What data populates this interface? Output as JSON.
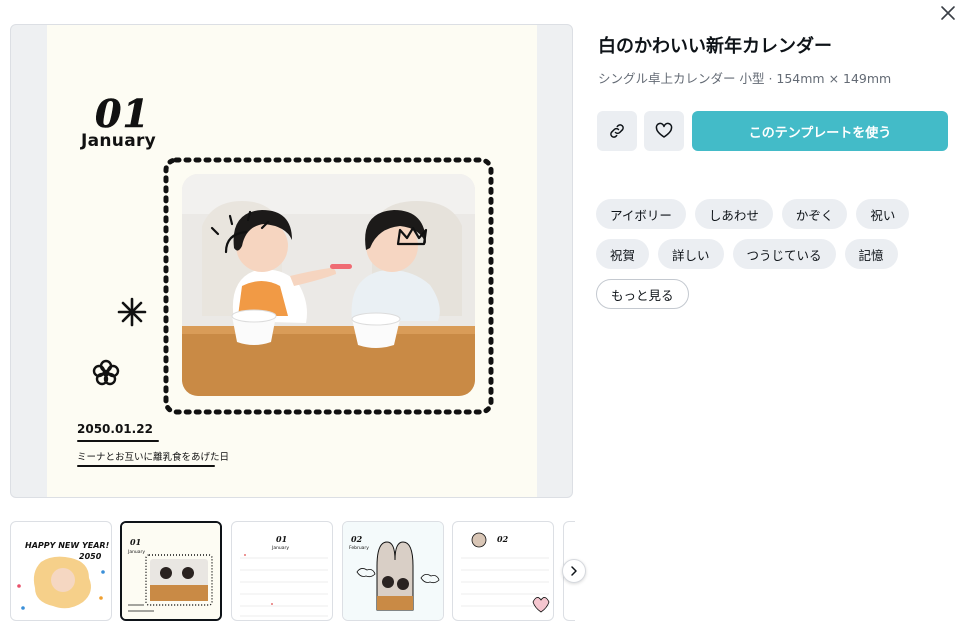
{
  "template": {
    "title": "白のかわいい新年カレンダー",
    "subtitle": "シングル卓上カレンダー 小型 · 154mm × 149mm"
  },
  "preview": {
    "month_number": "01",
    "month_name": "January",
    "date": "2050.01.22",
    "caption": "ミーナとお互いに離乳食をあげた日"
  },
  "actions": {
    "copy_link_icon": "link-icon",
    "favorite_icon": "heart-icon",
    "use_template_label": "このテンプレートを使う",
    "close_icon": "close-icon"
  },
  "tags": [
    "アイボリー",
    "しあわせ",
    "かぞく",
    "祝い",
    "祝賀",
    "詳しい",
    "つうじている",
    "記憶"
  ],
  "more_label": "もっと見る",
  "thumbnails": {
    "selected_index": 1,
    "items": [
      {
        "text_1": "HAPPY NEW YEAR!",
        "text_2": "2050"
      },
      {
        "text_1": "01",
        "text_2": "January"
      },
      {
        "text_1": "01",
        "text_2": "January"
      },
      {
        "text_1": "02",
        "text_2": "February"
      },
      {
        "text_1": "02",
        "text_2": ""
      }
    ],
    "next_icon": "chevron-right-icon"
  },
  "colors": {
    "accent": "#43bbc8",
    "page_background": "#fdfcf3",
    "chip_background": "#ebeef2"
  }
}
